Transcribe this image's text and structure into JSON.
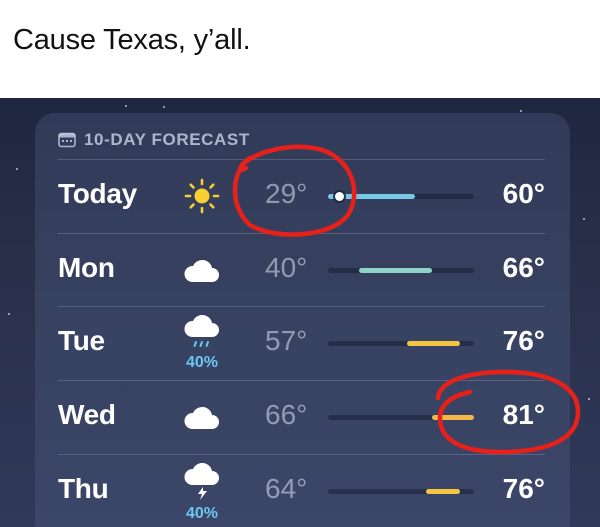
{
  "caption": "Cause Texas, y’all.",
  "forecast": {
    "header": "10-DAY FORECAST",
    "rows": [
      {
        "day": "Today",
        "icon": "sun-icon",
        "lo": "29°",
        "hi": "60°",
        "precip": "",
        "low_value": 29,
        "high_value": 60,
        "bar_color": "#75c8e6",
        "current_temp_marker": true
      },
      {
        "day": "Mon",
        "icon": "cloud-icon",
        "lo": "40°",
        "hi": "66°",
        "precip": "",
        "low_value": 40,
        "high_value": 66,
        "bar_color": "#8fd2c6"
      },
      {
        "day": "Tue",
        "icon": "rain-cloud-icon",
        "lo": "57°",
        "hi": "76°",
        "precip": "40%",
        "low_value": 57,
        "high_value": 76,
        "bar_color": "#f4c542"
      },
      {
        "day": "Wed",
        "icon": "cloud-icon",
        "lo": "66°",
        "hi": "81°",
        "precip": "",
        "low_value": 66,
        "high_value": 81,
        "bar_color": "#f2b84a"
      },
      {
        "day": "Thu",
        "icon": "thunder-cloud-icon",
        "lo": "64°",
        "hi": "76°",
        "precip": "40%",
        "low_value": 64,
        "high_value": 76,
        "bar_color": "#f4c542"
      }
    ],
    "temp_scale": {
      "min": 29,
      "max": 81
    },
    "current_temp": 33
  },
  "colors": {
    "annotation": "#e8201a",
    "precip": "#6dc6f0"
  }
}
